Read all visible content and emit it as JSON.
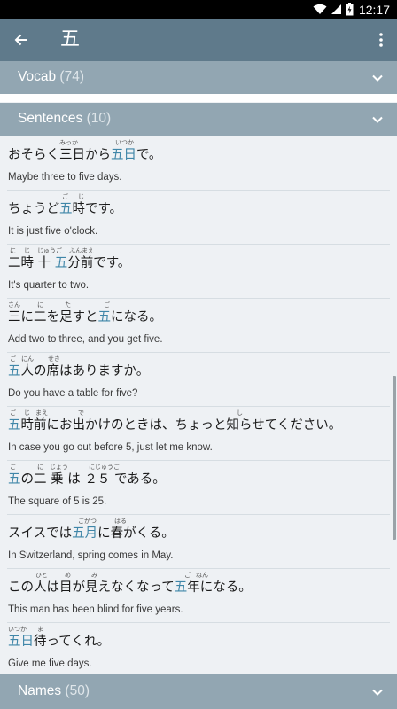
{
  "status_bar": {
    "time": "12:17"
  },
  "app_bar": {
    "title": "五"
  },
  "sections": {
    "vocab": {
      "label": "Vocab",
      "count": "(74)"
    },
    "sentences": {
      "label": "Sentences",
      "count": "(10)"
    },
    "names": {
      "label": "Names",
      "count": "(50)"
    }
  },
  "sentences": [
    {
      "segments": [
        {
          "t": "おそらく",
          "h": false
        },
        {
          "t": "三日",
          "h": false
        },
        {
          "t": "から",
          "h": false
        },
        {
          "t": "五日",
          "h": true
        },
        {
          "t": "で。",
          "h": false
        }
      ],
      "ruby": [
        {
          "t": "みっか"
        },
        {
          "t": "いつか"
        }
      ],
      "english": "Maybe three to five days."
    },
    {
      "segments": [
        {
          "t": "ちょうど",
          "h": false
        },
        {
          "t": "五",
          "h": true
        },
        {
          "t": "時です。",
          "h": false
        }
      ],
      "ruby": [
        {
          "t": "ご"
        },
        {
          "t": "じ"
        }
      ],
      "english": "It is just five o'clock."
    },
    {
      "segments": [
        {
          "t": "二時",
          "h": false
        },
        {
          "t": " 十 ",
          "h": false
        },
        {
          "t": "五",
          "h": true
        },
        {
          "t": "分前です。",
          "h": false
        }
      ],
      "ruby": [
        {
          "t": "に"
        },
        {
          "t": "じ"
        },
        {
          "t": "じゅう"
        },
        {
          "t": "ご"
        },
        {
          "t": "ふんまえ"
        }
      ],
      "english": "It's quarter to two."
    },
    {
      "segments": [
        {
          "t": "三",
          "h": false
        },
        {
          "t": "に",
          "h": false
        },
        {
          "t": "二",
          "h": false
        },
        {
          "t": "を",
          "h": false
        },
        {
          "t": "足",
          "h": false
        },
        {
          "t": "すと",
          "h": false
        },
        {
          "t": "五",
          "h": true
        },
        {
          "t": "になる。",
          "h": false
        }
      ],
      "ruby": [
        {
          "t": "さん"
        },
        {
          "t": "に"
        },
        {
          "t": "た"
        },
        {
          "t": "ご"
        }
      ],
      "english": "Add two to three, and you get five."
    },
    {
      "segments": [
        {
          "t": "五",
          "h": true
        },
        {
          "t": "人",
          "h": false
        },
        {
          "t": "の",
          "h": false
        },
        {
          "t": "席",
          "h": false
        },
        {
          "t": "はありますか。",
          "h": false
        }
      ],
      "ruby": [
        {
          "t": "ご"
        },
        {
          "t": "にん"
        },
        {
          "t": "せき"
        }
      ],
      "english": "Do you have a table for five?"
    },
    {
      "segments": [
        {
          "t": "五",
          "h": true
        },
        {
          "t": "時前",
          "h": false
        },
        {
          "t": "にお",
          "h": false
        },
        {
          "t": "出",
          "h": false
        },
        {
          "t": "かけのときは、ちょっと",
          "h": false
        },
        {
          "t": "知",
          "h": false
        },
        {
          "t": "らせてください。",
          "h": false
        }
      ],
      "ruby": [
        {
          "t": "ご"
        },
        {
          "t": "じ"
        },
        {
          "t": "まえ"
        },
        {
          "t": "で"
        },
        {
          "t": "し"
        }
      ],
      "english": "In case you go out before 5, just let me know."
    },
    {
      "segments": [
        {
          "t": "五",
          "h": true
        },
        {
          "t": "の",
          "h": false
        },
        {
          "t": "二 ",
          "h": false
        },
        {
          "t": "乗 ",
          "h": false
        },
        {
          "t": "は ",
          "h": false
        },
        {
          "t": "２５ ",
          "h": false
        },
        {
          "t": "である。",
          "h": false
        }
      ],
      "ruby": [
        {
          "t": "ご"
        },
        {
          "t": "に"
        },
        {
          "t": "じょう"
        },
        {
          "t": "にじゅうご"
        }
      ],
      "english": "The square of 5 is 25."
    },
    {
      "segments": [
        {
          "t": "スイスでは",
          "h": false
        },
        {
          "t": "五月",
          "h": true
        },
        {
          "t": "に",
          "h": false
        },
        {
          "t": "春",
          "h": false
        },
        {
          "t": "がくる。",
          "h": false
        }
      ],
      "ruby": [
        {
          "t": "ごがつ"
        },
        {
          "t": "はる"
        }
      ],
      "english": "In Switzerland, spring comes in May."
    },
    {
      "segments": [
        {
          "t": "この",
          "h": false
        },
        {
          "t": "人",
          "h": false
        },
        {
          "t": "は",
          "h": false
        },
        {
          "t": "目",
          "h": false
        },
        {
          "t": "が",
          "h": false
        },
        {
          "t": "見",
          "h": false
        },
        {
          "t": "えなくなって",
          "h": false
        },
        {
          "t": "五",
          "h": true
        },
        {
          "t": "年",
          "h": false
        },
        {
          "t": "になる。",
          "h": false
        }
      ],
      "ruby": [
        {
          "t": "ひと"
        },
        {
          "t": "め"
        },
        {
          "t": "み"
        },
        {
          "t": "ご"
        },
        {
          "t": "ねん"
        }
      ],
      "english": "This man has been blind for five years."
    },
    {
      "segments": [
        {
          "t": "五日",
          "h": true
        },
        {
          "t": "待",
          "h": false
        },
        {
          "t": "ってくれ。",
          "h": false
        }
      ],
      "ruby": [
        {
          "t": "いつか"
        },
        {
          "t": "ま"
        }
      ],
      "english": "Give me five days."
    }
  ]
}
